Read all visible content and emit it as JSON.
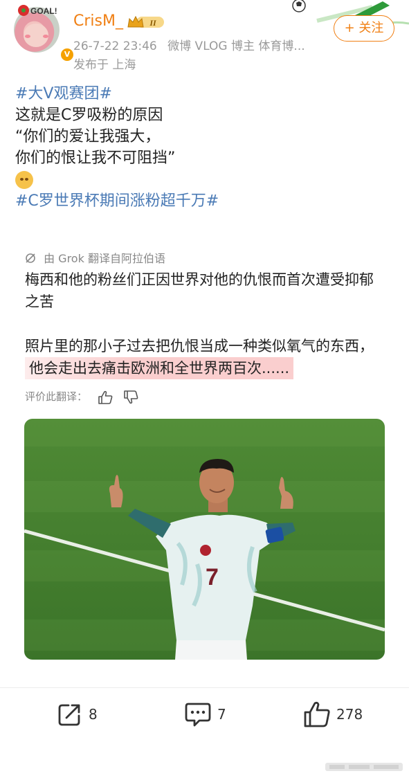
{
  "header": {
    "username": "CrisM_",
    "level_badge": "II",
    "avatar_badge_text": "GOAL!",
    "verified_badge": "V",
    "timestamp": "26-7-22 23:46",
    "source": "微博 VLOG 博主 体育博...",
    "location": "发布于 上海",
    "follow_label": "+ 关注"
  },
  "post": {
    "hashtag1": "#大V观赛团#",
    "line1": "这就是C罗吸粉的原因",
    "line2": "“你们的爱让我强大，",
    "line3": "你们的恨让我不可阻挡”",
    "hashtag2": "#C罗世界杯期间涨粉超千万#"
  },
  "translation": {
    "source_label": "由 Grok 翻译自阿拉伯语",
    "para1": "梅西和他的粉丝们正因世界对他的仇恨而首次遭受抑郁之苦",
    "para2_plain": "照片里的那小子过去把仇恨当成一种类似氧气的东西，",
    "para2_highlight": "他会走出去痛击欧洲和全世界两百次......",
    "rate_label": "评价此翻译："
  },
  "photo": {
    "jersey_number": "7"
  },
  "actions": {
    "share_count": "8",
    "comment_count": "7",
    "like_count": "278"
  },
  "icons": {
    "share": "share-icon",
    "comment": "comment-icon",
    "like": "like-icon",
    "thumbs_up": "thumbs-up-icon",
    "thumbs_down": "thumbs-down-icon",
    "grok": "grok-icon"
  },
  "colors": {
    "accent": "#f07f13",
    "hashtag": "#4a7ab5",
    "muted": "#999999",
    "highlight": "#f8bebe"
  }
}
